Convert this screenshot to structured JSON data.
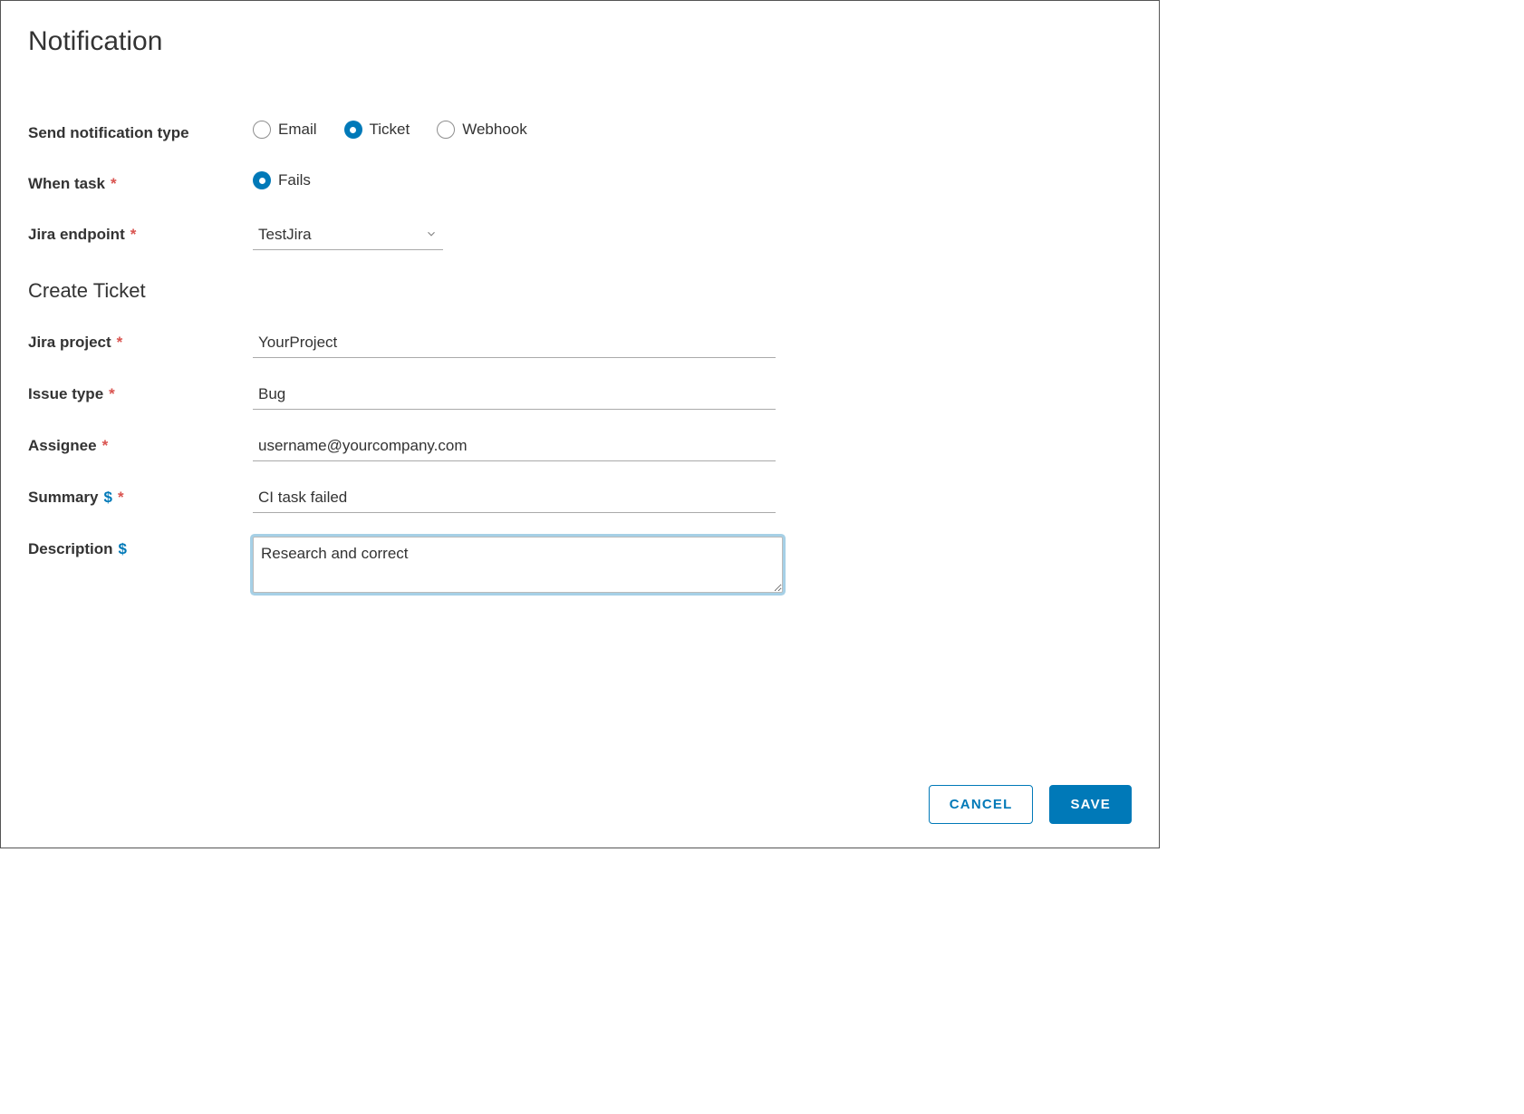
{
  "title": "Notification",
  "labels": {
    "send_type": "Send notification type",
    "when_task": "When task",
    "jira_endpoint": "Jira endpoint",
    "create_ticket": "Create Ticket",
    "jira_project": "Jira project",
    "issue_type": "Issue type",
    "assignee": "Assignee",
    "summary": "Summary",
    "description": "Description"
  },
  "send_type_options": {
    "email": "Email",
    "ticket": "Ticket",
    "webhook": "Webhook",
    "selected": "ticket"
  },
  "when_task_options": {
    "fails": "Fails",
    "selected": "fails"
  },
  "fields": {
    "jira_endpoint": "TestJira",
    "jira_project": "YourProject",
    "issue_type": "Bug",
    "assignee": "username@yourcompany.com",
    "summary": "CI task failed",
    "description": "Research and correct"
  },
  "buttons": {
    "cancel": "CANCEL",
    "save": "SAVE"
  },
  "markers": {
    "required": "*",
    "variable": "$"
  }
}
